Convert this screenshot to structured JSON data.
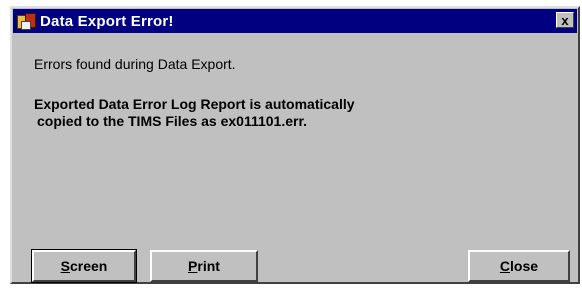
{
  "window": {
    "title": "Data Export Error!",
    "close_glyph": "x"
  },
  "message": {
    "line1": "Errors found during Data Export.",
    "line2": "Exported Data Error Log Report is automatically",
    "line3": "copied to the TIMS Files as ex011101.err."
  },
  "buttons": {
    "screen": {
      "mnemonic": "S",
      "rest": "creen"
    },
    "print": {
      "mnemonic": "P",
      "rest": "rint"
    },
    "close": {
      "mnemonic": "C",
      "rest": "lose"
    }
  },
  "colors": {
    "titlebar": "#000080",
    "face": "#c0c0c0"
  },
  "icons": {
    "app": "app-icon",
    "close": "close-icon"
  }
}
